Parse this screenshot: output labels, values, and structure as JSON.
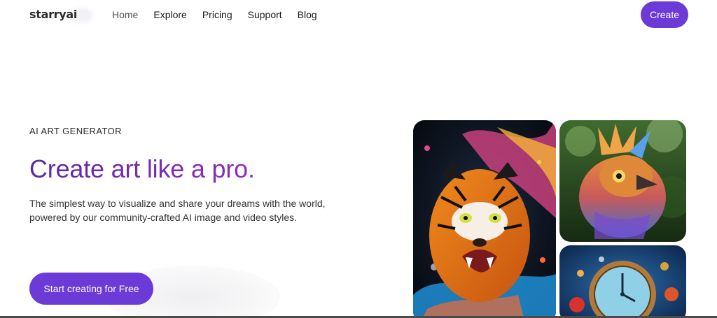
{
  "brand": {
    "logo": "starryai"
  },
  "nav": {
    "links": [
      "Home",
      "Explore",
      "Pricing",
      "Support",
      "Blog"
    ],
    "create_label": "Create"
  },
  "hero": {
    "eyebrow": "AI ART GENERATOR",
    "title": "Create art like a pro.",
    "description": "The simplest way to visualize and share your dreams with the world, powered by our community-crafted AI image and video styles.",
    "cta_label": "Start creating for Free"
  },
  "gallery": {
    "images": [
      "tiger-artwork",
      "bird-artwork",
      "clock-artwork"
    ]
  },
  "colors": {
    "accent": "#6c3ad6",
    "title_gradient_start": "#5a2aa8",
    "title_gradient_end": "#8e2dc2"
  }
}
